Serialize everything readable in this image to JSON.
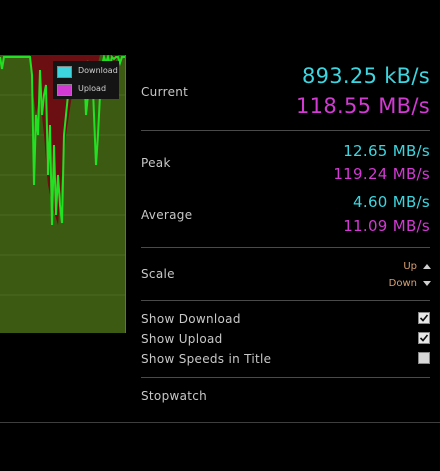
{
  "colors": {
    "download": "#3dd6e0",
    "upload": "#d23ad3",
    "graph_background": "#3d5a12",
    "download_line": "#22e022",
    "upload_fill": "#6b0f12"
  },
  "legend": {
    "download": "Download",
    "upload": "Upload"
  },
  "current": {
    "label": "Current",
    "download": "893.25 kB/s",
    "upload": "118.55 MB/s"
  },
  "peak": {
    "label": "Peak",
    "download": "12.65 MB/s",
    "upload": "119.24 MB/s"
  },
  "average": {
    "label": "Average",
    "download": "4.60 MB/s",
    "upload": "11.09 MB/s"
  },
  "scale": {
    "label": "Scale",
    "up": "Up",
    "down": "Down"
  },
  "options": [
    {
      "label": "Show Download",
      "checked": true
    },
    {
      "label": "Show Upload",
      "checked": true
    },
    {
      "label": "Show Speeds in Title",
      "checked": false
    }
  ],
  "stopwatch": {
    "label": "Stopwatch"
  }
}
